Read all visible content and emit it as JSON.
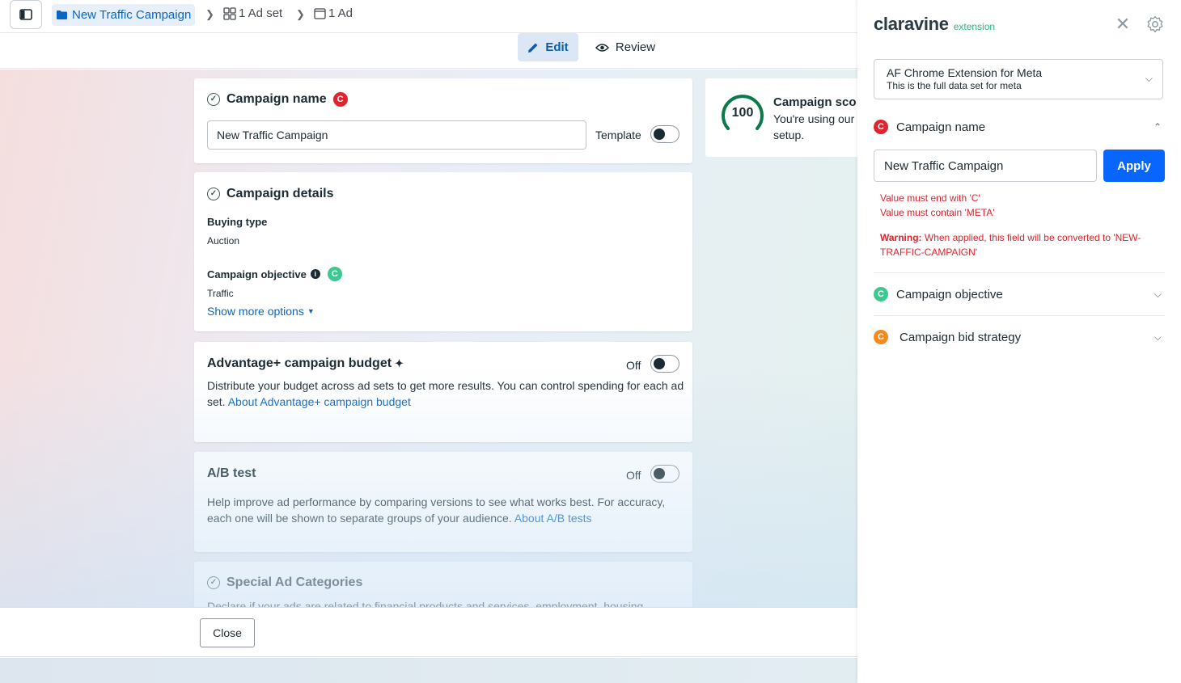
{
  "breadcrumb": {
    "campaign": "New Traffic Campaign",
    "adset": "1 Ad set",
    "ad": "1 Ad"
  },
  "tabs": {
    "edit": "Edit",
    "review": "Review"
  },
  "campaign_name_card": {
    "title": "Campaign name",
    "input_value": "New Traffic Campaign",
    "template_label": "Template"
  },
  "campaign_details_card": {
    "title": "Campaign details",
    "buying_type_label": "Buying type",
    "buying_type_value": "Auction",
    "objective_label": "Campaign objective",
    "objective_value": "Traffic",
    "show_more": "Show more options"
  },
  "budget_card": {
    "title": "Advantage+ campaign budget",
    "toggle_label": "Off",
    "description": "Distribute your budget across ad sets to get more results. You can control spending for each ad set.",
    "link": "About Advantage+ campaign budget"
  },
  "ab_card": {
    "title": "A/B test",
    "toggle_label": "Off",
    "description": "Help improve ad performance by comparing versions to see what works best. For accuracy, each one will be shown to separate groups of your audience.",
    "link": "About A/B tests"
  },
  "special_card": {
    "title": "Special Ad Categories",
    "description": "Declare if your ads are related to financial products and services, employment, housing"
  },
  "score_card": {
    "score": "100",
    "title": "Campaign sco",
    "text_line1": "You're using our",
    "text_line2": "setup."
  },
  "footer": {
    "close": "Close"
  },
  "extension": {
    "logo": "claravine",
    "logo_sub": "extension",
    "dataset_title": "AF Chrome Extension for Meta",
    "dataset_sub": "This is the full data set for meta",
    "sections": {
      "campaign_name": "Campaign name",
      "campaign_objective": "Campaign objective",
      "bid_strategy": "Campaign bid strategy"
    },
    "input_value": "New Traffic Campaign",
    "apply": "Apply",
    "errors": [
      "Value must end with 'C'",
      "Value must contain 'META'"
    ],
    "warning_label": "Warning:",
    "warning_text": " When applied, this field will be converted to 'NEW-TRAFFIC-CAMPAIGN'"
  },
  "colors": {
    "accent_blue": "#0866ff",
    "error_red": "#e0242f",
    "claravine_green": "#3cc88e",
    "claravine_orange": "#f58a1f"
  }
}
